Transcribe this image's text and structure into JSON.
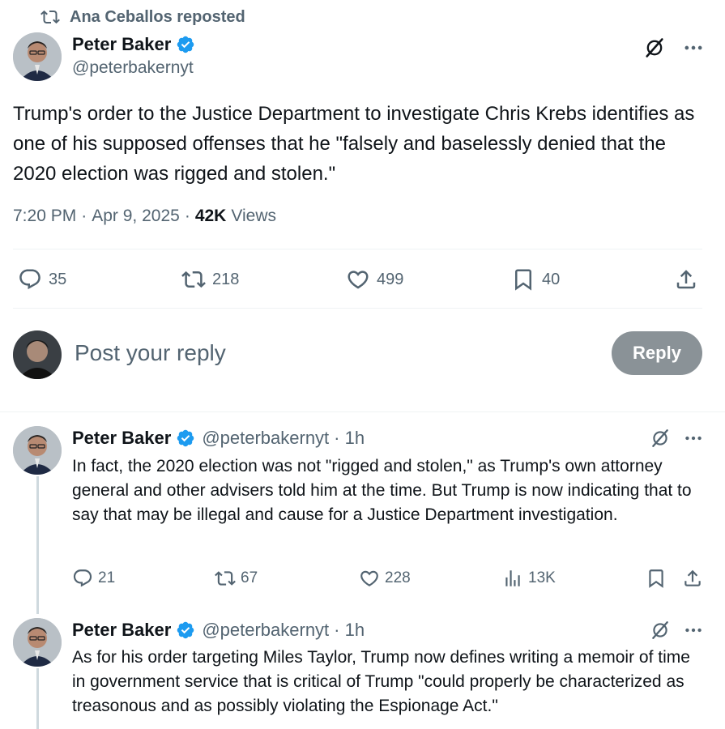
{
  "repost": {
    "text": "Ana Ceballos reposted"
  },
  "main_post": {
    "author_name": "Peter Baker",
    "handle": "@peterbakernyt",
    "text": "Trump's order to the Justice Department to investigate Chris Krebs identifies as one of his supposed offenses that he \"falsely and baselessly denied that the 2020 election was rigged and stolen.\"",
    "time": "7:20 PM",
    "date": "Apr 9, 2025",
    "views_count": "42K",
    "views_label": "Views",
    "replies": "35",
    "reposts": "218",
    "likes": "499",
    "bookmarks": "40"
  },
  "reply_box": {
    "placeholder": "Post your reply",
    "button_label": "Reply"
  },
  "thread": [
    {
      "author_name": "Peter Baker",
      "handle": "@peterbakernyt",
      "time": "· 1h",
      "text": "In fact, the 2020 election was not \"rigged and stolen,\" as Trump's own attorney general and other advisers told him at the time. But Trump is now indicating that to say that may be illegal and cause for a Justice Department investigation.",
      "replies": "21",
      "reposts": "67",
      "likes": "228",
      "views": "13K"
    },
    {
      "author_name": "Peter Baker",
      "handle": "@peterbakernyt",
      "time": "· 1h",
      "text": "As for his order targeting Miles Taylor, Trump now defines writing a memoir of time in government service that is critical of Trump \"could properly be characterized as treasonous and as possibly violating the Espionage Act.\""
    }
  ],
  "colors": {
    "verified": "#1d9bf0",
    "secondary_text": "#536471",
    "reply_button": "#8a9297"
  },
  "icons": [
    "repost-icon",
    "verified-badge-icon",
    "grok-icon",
    "more-icon",
    "reply-icon",
    "like-icon",
    "bookmark-icon",
    "share-icon",
    "views-icon"
  ]
}
